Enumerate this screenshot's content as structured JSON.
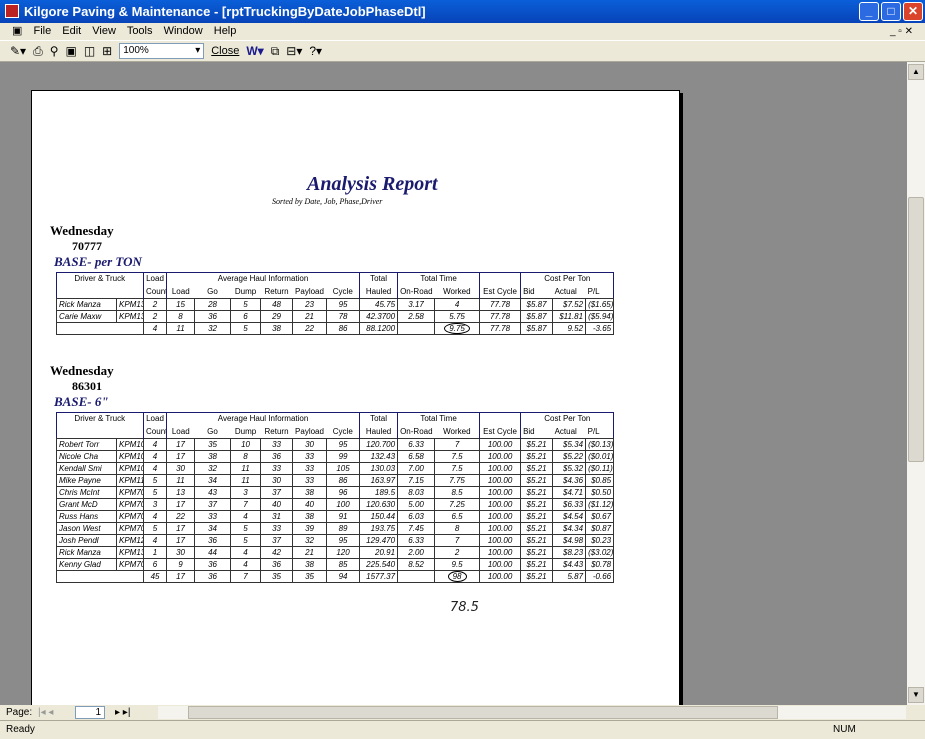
{
  "window": {
    "title": "Kilgore Paving & Maintenance - [rptTruckingByDateJobPhaseDtl]"
  },
  "menu": [
    "File",
    "Edit",
    "View",
    "Tools",
    "Window",
    "Help"
  ],
  "toolbar": {
    "zoom": "100%",
    "close": "Close"
  },
  "report": {
    "title": "Analysis Report",
    "subtitle": "Sorted by Date, Job, Phase,Driver",
    "headers": {
      "driver": "Driver & Truck",
      "load1": "Load",
      "count": "Count",
      "avg": "Average Haul Information",
      "load": "Load",
      "go": "Go",
      "dump": "Dump",
      "return": "Return",
      "payload": "Payload",
      "cycle": "Cycle",
      "total": "Total",
      "hauled": "Hauled",
      "tt": "Total Time",
      "onroad": "On-Road",
      "worked": "Worked",
      "estcycle": "Est Cycle",
      "cpt": "Cost Per Ton",
      "bid": "Bid",
      "actual": "Actual",
      "pl": "P/L"
    },
    "sections": [
      {
        "day": "Wednesday",
        "job": "70777",
        "phase": "BASE- per TON",
        "rows": [
          [
            "Rick Manza",
            "KPM132",
            "2",
            "15",
            "28",
            "5",
            "48",
            "23",
            "95",
            "45.75",
            "3.17",
            "4",
            "77.78",
            "$5.87",
            "$7.52",
            "($1.65)"
          ],
          [
            "Carie Maxw",
            "KPM133",
            "2",
            "8",
            "36",
            "6",
            "29",
            "21",
            "78",
            "42.3700",
            "2.58",
            "5.75",
            "77.78",
            "$5.87",
            "$11.81",
            "($5.94)"
          ]
        ],
        "total": [
          "",
          "",
          "4",
          "11",
          "32",
          "5",
          "38",
          "22",
          "86",
          "88.1200",
          "",
          "9.75",
          "77.78",
          "$5.87",
          "9.52",
          "-3.65"
        ]
      },
      {
        "day": "Wednesday",
        "job": "86301",
        "phase": "BASE- 6\"",
        "rows": [
          [
            "Robert Torr",
            "KPM102P",
            "4",
            "17",
            "35",
            "10",
            "33",
            "30",
            "95",
            "120.700",
            "6.33",
            "7",
            "100.00",
            "$5.21",
            "$5.34",
            "($0.13)"
          ],
          [
            "Nicole Cha",
            "KPM108P",
            "4",
            "17",
            "38",
            "8",
            "36",
            "33",
            "99",
            "132.43",
            "6.58",
            "7.5",
            "100.00",
            "$5.21",
            "$5.22",
            "($0.01)"
          ],
          [
            "Kendall Smi",
            "KPM109P",
            "4",
            "30",
            "32",
            "11",
            "33",
            "33",
            "105",
            "130.03",
            "7.00",
            "7.5",
            "100.00",
            "$5.21",
            "$5.32",
            "($0.11)"
          ],
          [
            "Mike Payne",
            "KPM110P",
            "5",
            "11",
            "34",
            "11",
            "30",
            "33",
            "86",
            "163.97",
            "7.15",
            "7.75",
            "100.00",
            "$5.21",
            "$4.36",
            "$0.85"
          ],
          [
            "Chris McInt",
            "KPM703P",
            "5",
            "13",
            "43",
            "3",
            "37",
            "38",
            "96",
            "189.5",
            "8.03",
            "8.5",
            "100.00",
            "$5.21",
            "$4.71",
            "$0.50"
          ],
          [
            "Grant McD",
            "KPM705P",
            "3",
            "17",
            "37",
            "7",
            "40",
            "40",
            "100",
            "120.630",
            "5.00",
            "7.25",
            "100.00",
            "$5.21",
            "$6.33",
            "($1.12)"
          ],
          [
            "Russ Hans",
            "KPM704P",
            "4",
            "22",
            "33",
            "4",
            "31",
            "38",
            "91",
            "150.44",
            "6.03",
            "6.5",
            "100.00",
            "$5.21",
            "$4.54",
            "$0.67"
          ],
          [
            "Jason West",
            "KPM706P",
            "5",
            "17",
            "34",
            "5",
            "33",
            "39",
            "89",
            "193.75",
            "7.45",
            "8",
            "100.00",
            "$5.21",
            "$4.34",
            "$0.87"
          ],
          [
            "Josh Pendl",
            "KPM124P",
            "4",
            "17",
            "36",
            "5",
            "37",
            "32",
            "95",
            "129.470",
            "6.33",
            "7",
            "100.00",
            "$5.21",
            "$4.98",
            "$0.23"
          ],
          [
            "Rick Manza",
            "KPM132",
            "1",
            "30",
            "44",
            "4",
            "42",
            "21",
            "120",
            "20.91",
            "2.00",
            "2",
            "100.00",
            "$5.21",
            "$8.23",
            "($3.02)"
          ],
          [
            "Kenny Glad",
            "KPM708p",
            "6",
            "9",
            "36",
            "4",
            "36",
            "38",
            "85",
            "225.540",
            "8.52",
            "9.5",
            "100.00",
            "$5.21",
            "$4.43",
            "$0.78"
          ]
        ],
        "total": [
          "",
          "",
          "45",
          "17",
          "36",
          "7",
          "35",
          "35",
          "94",
          "1577.37",
          "",
          "98",
          "100.00",
          "$5.21",
          "5.87",
          "-0.66"
        ]
      }
    ],
    "handwritten_note": "78.5"
  },
  "nav": {
    "page_label": "Page:",
    "page": "1"
  },
  "status": {
    "text": "Ready",
    "num": "NUM"
  }
}
